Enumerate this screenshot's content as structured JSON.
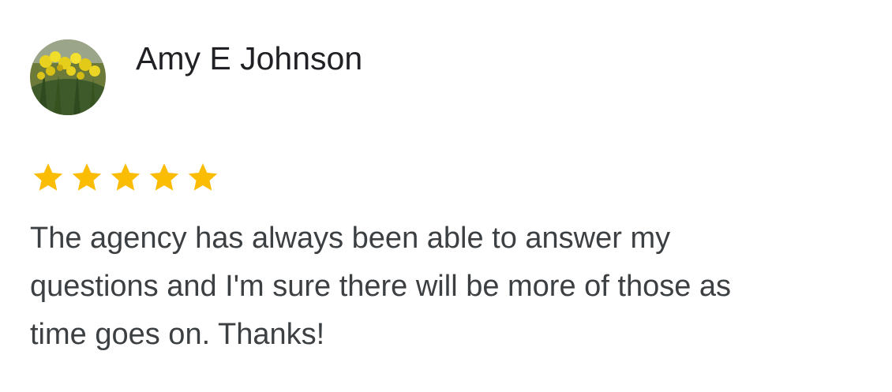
{
  "review": {
    "reviewer_name": "Amy E Johnson",
    "avatar_icon": "daffodil-photo-avatar",
    "rating": 5,
    "rating_max": 5,
    "star_color": "#fbbc04",
    "text_line_1": "The agency has always been able to answer my",
    "text_line_2": "questions and I'm sure there will be more of those as",
    "text_line_3": "time goes on. Thanks!"
  }
}
